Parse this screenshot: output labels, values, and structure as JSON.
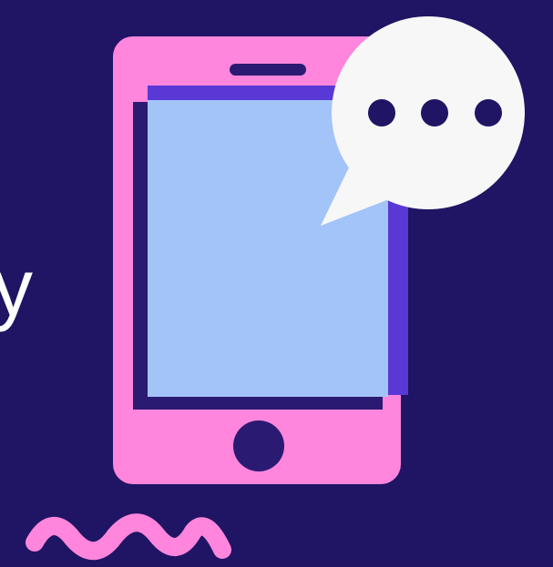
{
  "visible_text_fragment": "y",
  "icons": {
    "phone": "smartphone-icon",
    "chat": "speech-bubble-ellipsis-icon",
    "wave": "zigzag-squiggle-icon"
  },
  "colors": {
    "background": "#1f1564",
    "phone_body": "#ff86dc",
    "phone_shadow": "#2b1a72",
    "screen_back": "#5a38d6",
    "screen": "#a3c4f8",
    "bubble": "#f7f7f7",
    "dots": "#1f1564",
    "wave": "#ff86dc",
    "text": "#ffffff"
  }
}
